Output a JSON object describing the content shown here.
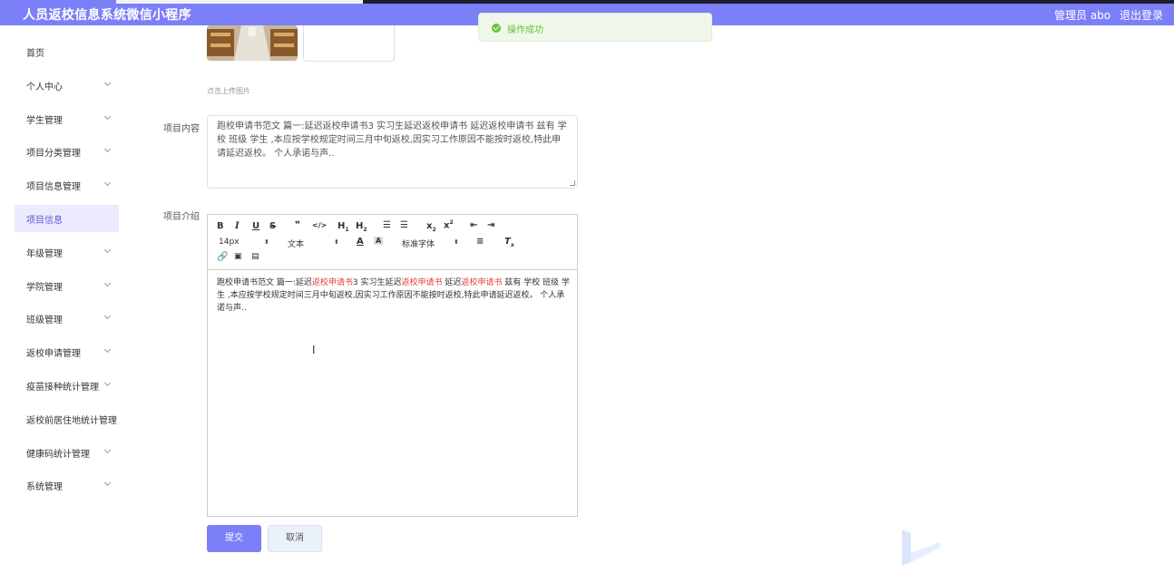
{
  "header": {
    "title": "人员返校信息系统微信小程序",
    "admin": "管理员 abo",
    "logout": "退出登录"
  },
  "toast": {
    "message": "操作成功",
    "icon": "check-circle-icon"
  },
  "sidebar": {
    "items": [
      {
        "label": "首页",
        "expandable": false,
        "active": false
      },
      {
        "label": "个人中心",
        "expandable": true,
        "active": false
      },
      {
        "label": "学生管理",
        "expandable": true,
        "active": false
      },
      {
        "label": "项目分类管理",
        "expandable": true,
        "active": false
      },
      {
        "label": "项目信息管理",
        "expandable": true,
        "active": false
      },
      {
        "label": "项目信息",
        "expandable": false,
        "active": true
      },
      {
        "label": "年级管理",
        "expandable": true,
        "active": false
      },
      {
        "label": "学院管理",
        "expandable": true,
        "active": false
      },
      {
        "label": "班级管理",
        "expandable": true,
        "active": false
      },
      {
        "label": "返校申请管理",
        "expandable": true,
        "active": false
      },
      {
        "label": "疫苗接种统计管理",
        "expandable": true,
        "active": false
      },
      {
        "label": "返校前居住地统计管理",
        "expandable": false,
        "active": false
      },
      {
        "label": "健康码统计管理",
        "expandable": true,
        "active": false
      },
      {
        "label": "系统管理",
        "expandable": true,
        "active": false
      }
    ]
  },
  "form": {
    "upload_hint": "点击上传图片",
    "content_label": "项目内容",
    "content_value": "跑校申请书范文 篇一:延迟返校申请书3 实习生延迟返校申请书 延迟返校申请书 兹有 学校 班级 学生 ,本应按学校规定时间三月中旬返校,因实习工作原因不能按时返校,特此申请延迟返校。 个人承诺与声..",
    "intro_label": "项目介绍",
    "editor": {
      "font_size": "14px",
      "block_type": "文本",
      "font_family": "标准字体",
      "body_parts": [
        {
          "text": "跑校申请书范文 篇一:延迟",
          "highlight": false
        },
        {
          "text": "返校申请书",
          "highlight": true
        },
        {
          "text": "3 实习生延迟",
          "highlight": false
        },
        {
          "text": "返校申请书",
          "highlight": true
        },
        {
          "text": " 延迟",
          "highlight": false
        },
        {
          "text": "返校申请书",
          "highlight": true
        },
        {
          "text": " 兹有 学校 班级 学生 ,本应按学校规定时间三月中旬返校,因实习工作原因不能按时返校,特此申请延迟返校。 个人承诺与声..",
          "highlight": false
        }
      ],
      "highlight_color": "#e03e3e"
    },
    "submit_label": "提交",
    "cancel_label": "取消"
  },
  "colors": {
    "brand": "#7b7ff8",
    "success": "#67c23a",
    "active_bg": "#ecebfd"
  }
}
